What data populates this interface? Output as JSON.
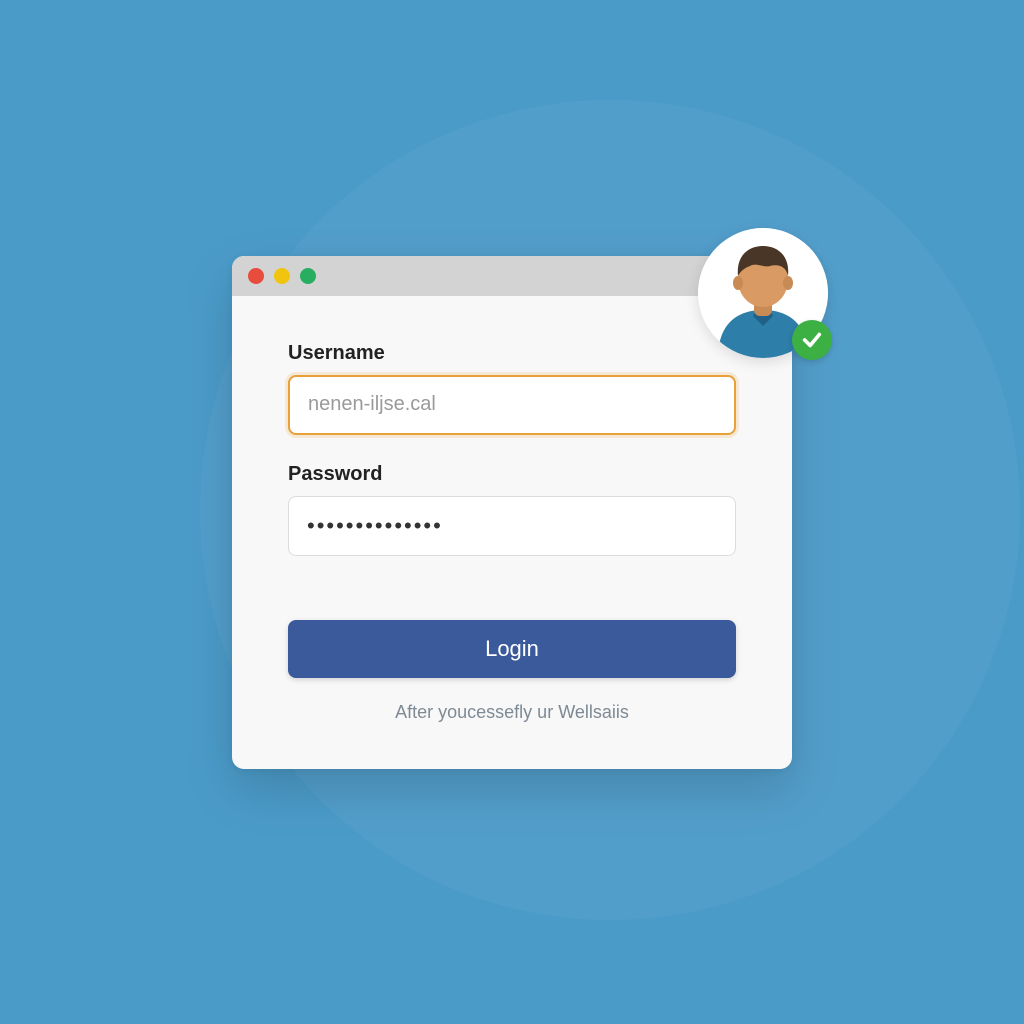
{
  "form": {
    "username_label": "Username",
    "username_placeholder": "nenen-iljse.cal",
    "password_label": "Password",
    "password_value_mask": "••••••••••••••",
    "login_label": "Login",
    "footer_text": "After youcessefly ur Wellsaiis"
  },
  "colors": {
    "background": "#4b9bc9",
    "window_bg": "#f8f8f8",
    "titlebar": "#d3d3d3",
    "button": "#3a5a9b",
    "focus_border": "#e8a13a",
    "check_badge": "#3cb043"
  },
  "icons": {
    "avatar": "user-avatar",
    "check": "checkmark"
  }
}
